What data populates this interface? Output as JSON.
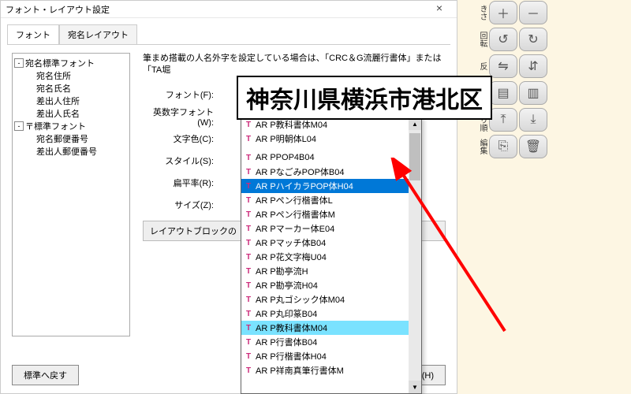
{
  "dialog": {
    "title": "フォント・レイアウト設定",
    "tabs": [
      "フォント",
      "宛名レイアウト"
    ],
    "active_tab": 0,
    "close_label": "×",
    "tree": [
      {
        "label": "宛名標準フォント",
        "expandable": true
      },
      {
        "child": true,
        "label": "宛名住所"
      },
      {
        "child": true,
        "label": "宛名氏名"
      },
      {
        "child": true,
        "label": "差出人住所"
      },
      {
        "child": true,
        "label": "差出人氏名"
      },
      {
        "label": "〒標準フォント",
        "expandable": true
      },
      {
        "child": true,
        "label": "宛名郵便番号"
      },
      {
        "child": true,
        "label": "差出人郵便番号"
      }
    ],
    "hint": "筆まめ搭載の人名外字を設定している場合は、「CRC＆G流麗行書体」または「TA堀",
    "labels": {
      "font": "フォント(F):",
      "alnum_font": "英数字フォント(W):",
      "text_color": "文字色(C):",
      "style": "スタイル(S):",
      "flatness": "扁平率(R):",
      "size": "サイズ(Z):"
    },
    "layout_block_btn": "レイアウトブロックの",
    "footer": {
      "restore": "標準へ戻す",
      "help": "ヘルプ(H)"
    }
  },
  "font_list": [
    "AR P教科書体M04",
    "AR P明朝体L04",
    "AR PPOP4B04",
    "AR PなごみPOP体B04",
    "AR PハイカラPOP体H04",
    "AR Pペン行楷書体L",
    "AR Pペン行楷書体M",
    "AR Pマーカー体E04",
    "AR Pマッチ体B04",
    "AR P花文字梅U04",
    "AR P勘亭流H",
    "AR P勘亭流H04",
    "AR P丸ゴシック体M04",
    "AR P丸印篆B04",
    "AR P教科書体M04",
    "AR P行書体B04",
    "AR P行楷書体H04",
    "AR P祥南真筆行書体M"
  ],
  "font_list_gap_after": 1,
  "font_hover_index": 4,
  "font_selected_index": 14,
  "toolbar": {
    "groups": [
      {
        "label": "きさ",
        "buttons": [
          "plus-icon",
          "minus-icon"
        ]
      },
      {
        "label": "回転",
        "buttons": [
          "rotate-ccw-icon",
          "rotate-cw-icon"
        ]
      },
      {
        "label": "反",
        "buttons": [
          "flip-h-icon",
          "flip-v-icon"
        ]
      },
      {
        "label": "",
        "buttons": [
          "layer-front-icon",
          "layer-back-icon"
        ]
      },
      {
        "label": "なり順",
        "buttons": [
          "bring-front-icon",
          "send-back-icon"
        ]
      },
      {
        "label": "編集",
        "buttons": [
          "copy-icon",
          "trash-icon"
        ]
      }
    ],
    "glyphs": {
      "plus-icon": "＋",
      "minus-icon": "－",
      "rotate-ccw-icon": "↺",
      "rotate-cw-icon": "↻",
      "flip-h-icon": "⇋",
      "flip-v-icon": "⇵",
      "layer-front-icon": "▤",
      "layer-back-icon": "▥",
      "bring-front-icon": "⤒",
      "send-back-icon": "⤓",
      "copy-icon": "⎘",
      "trash-icon": "🗑"
    }
  },
  "address_preview": "神奈川県横浜市港北区"
}
